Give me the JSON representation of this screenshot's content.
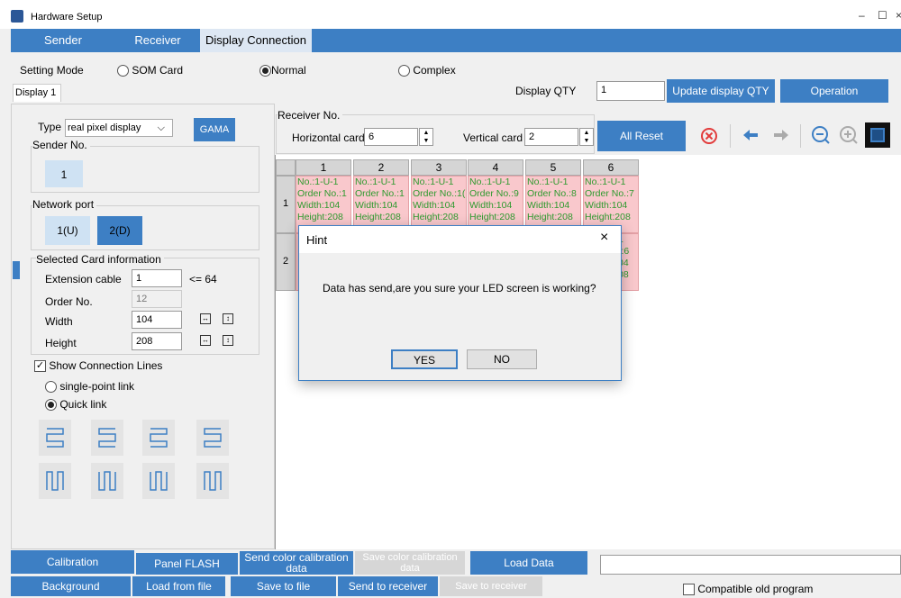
{
  "window": {
    "title": "Hardware Setup",
    "min": "–",
    "max": "☐",
    "close": "×"
  },
  "tabs": [
    "Sender",
    "Receiver",
    "Display Connection"
  ],
  "setting_mode": {
    "label": "Setting Mode",
    "options": [
      "SOM Card",
      "Normal",
      "Complex"
    ],
    "selected": "Normal"
  },
  "display_tab": "Display 1",
  "display_qty": {
    "label": "Display QTY",
    "value": "1"
  },
  "buttons": {
    "update": "Update display QTY",
    "operation": "Operation",
    "gama": "GAMA",
    "all_reset": "All Reset"
  },
  "type": {
    "label": "Type",
    "value": "real pixel display",
    "arrow": "⌵"
  },
  "sender_no": {
    "label": "Sender No.",
    "value": "1"
  },
  "network_port": {
    "label": "Network port",
    "ports": [
      "1(U)",
      "2(D)"
    ]
  },
  "selected_card": {
    "title": "Selected Card information",
    "extension": {
      "label": "Extension cable",
      "value": "1",
      "limit": "<= 64"
    },
    "order": {
      "label": "Order No.",
      "value": "12"
    },
    "width": {
      "label": "Width",
      "value": "104"
    },
    "height": {
      "label": "Height",
      "value": "208"
    }
  },
  "show_lines": {
    "label": "Show Connection Lines",
    "checked": true
  },
  "link": {
    "options": [
      "single-point link",
      "Quick link"
    ],
    "selected": "Quick link"
  },
  "receiver_no": {
    "label": "Receiver No.",
    "horizontal_label": "Horizontal card",
    "horizontal_value": "6",
    "vertical_label": "Vertical card",
    "vertical_value": "2"
  },
  "grid": {
    "columns": [
      "1",
      "2",
      "3",
      "4",
      "5",
      "6"
    ],
    "rows": [
      "1",
      "2"
    ],
    "row1_cells": [
      [
        "No.:1-U-1",
        "Order No.:1",
        "Width:104",
        "Height:208"
      ],
      [
        "No.:1-U-1",
        "Order No.:1",
        "Width:104",
        "Height:208"
      ],
      [
        "No.:1-U-1",
        "Order No.:1(",
        "Width:104",
        "Height:208"
      ],
      [
        "No.:1-U-1",
        "Order No.:9",
        "Width:104",
        "Height:208"
      ],
      [
        "No.:1-U-1",
        "Order No.:8",
        "Width:104",
        "Height:208"
      ],
      [
        "No.:1-U-1",
        "Order No.:7",
        "Width:104",
        "Height:208"
      ]
    ],
    "row2_visible_right": [
      "1",
      "):6",
      "04",
      "08"
    ]
  },
  "dialog": {
    "title": "Hint",
    "message": "Data has send,are you sure your LED screen is working?",
    "yes": "YES",
    "no": "NO",
    "close": "×"
  },
  "bottom_row1": [
    "Calibration",
    "Panel FLASH",
    "Send color calibration data",
    "Save color calibration data",
    "Load Data"
  ],
  "bottom_row2": [
    "Background",
    "Load from file",
    "Save to file",
    "Send to receiver",
    "Save to receiver"
  ],
  "compatible": {
    "label": "Compatible old program",
    "checked": false
  },
  "colors": {
    "accent": "#3d7fc4",
    "cell_bg": "#f9c8cc",
    "cell_text": "#2e9a2e",
    "reset_red": "#e23b3b"
  }
}
